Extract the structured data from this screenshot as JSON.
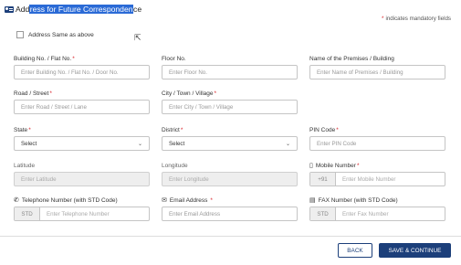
{
  "header": {
    "title_pre": "Add",
    "title_selected": "ress for Future Corresponden",
    "title_post": "ce"
  },
  "mandatory_note": "indicates mandatory fields",
  "same_as_above": {
    "label": "Address Same as above",
    "checked": false
  },
  "fields": {
    "building": {
      "label": "Building No. / Flat No.",
      "placeholder": "Enter Building No. / Flat No. / Door No."
    },
    "floor": {
      "label": "Floor No.",
      "placeholder": "Enter Floor No."
    },
    "premises": {
      "label": "Name of the Premises / Building",
      "placeholder": "Enter Name of Premises / Building"
    },
    "road": {
      "label": "Road / Street",
      "placeholder": "Enter Road / Street / Lane"
    },
    "city": {
      "label": "City / Town / Village",
      "placeholder": "Enter City / Town / Village"
    },
    "state": {
      "label": "State",
      "value": "Select"
    },
    "district": {
      "label": "District",
      "value": "Select"
    },
    "pin": {
      "label": "PIN Code",
      "placeholder": "Enter PIN Code"
    },
    "latitude": {
      "label": "Latitude",
      "placeholder": "Enter Latitude"
    },
    "longitude": {
      "label": "Longitude",
      "placeholder": "Enter Longitude"
    },
    "mobile": {
      "label": "Mobile Number",
      "prefix": "+91",
      "placeholder": "Enter Mobile Number"
    },
    "telephone": {
      "label": "Telephone Number (with STD Code)",
      "prefix": "STD",
      "placeholder": "Enter Telephone Number"
    },
    "email": {
      "label": "Email Address",
      "placeholder": "Enter Email Address"
    },
    "fax": {
      "label": "FAX Number (with STD Code)",
      "prefix": "STD",
      "placeholder": "Enter Fax Number"
    }
  },
  "buttons": {
    "back": "BACK",
    "save": "SAVE & CONTINUE"
  },
  "colors": {
    "primary": "#1c3f7a",
    "required": "#d9242b",
    "selection": "#2a6ad6"
  }
}
